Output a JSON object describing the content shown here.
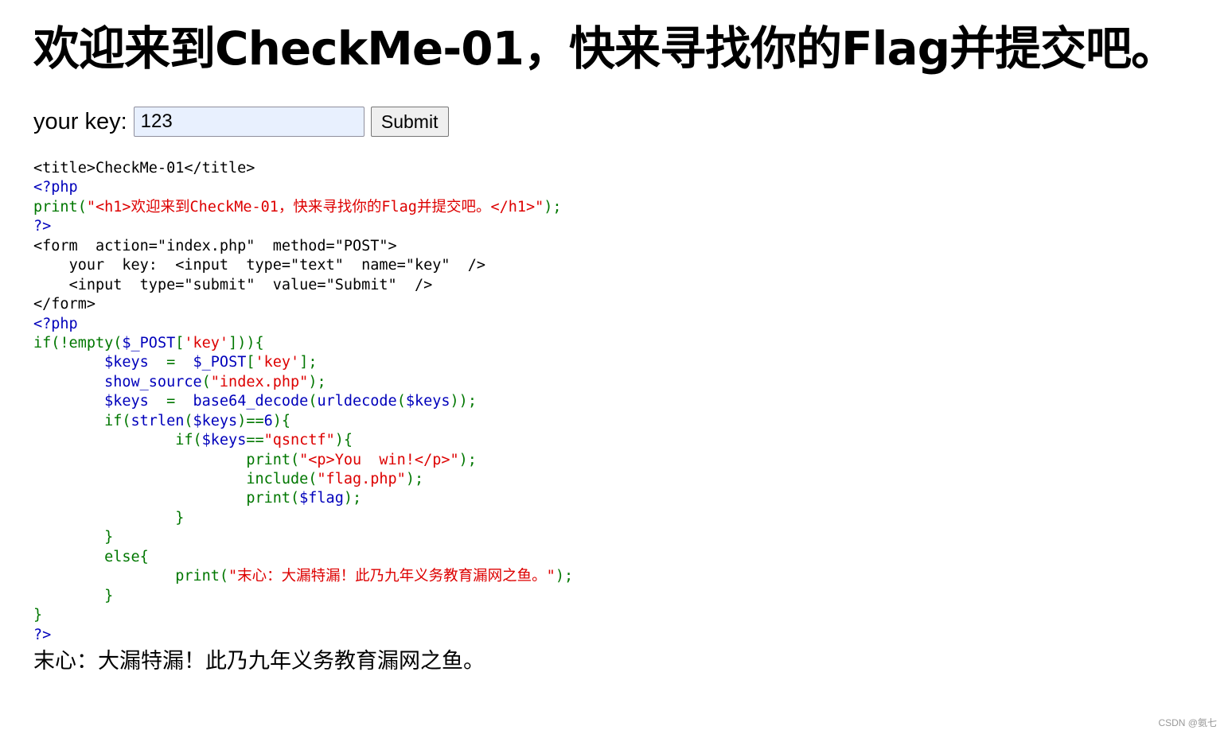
{
  "page": {
    "title": "欢迎来到CheckMe-01，快来寻找你的Flag并提交吧。"
  },
  "form": {
    "key_label": "your key:",
    "key_value": "123",
    "submit_label": "Submit"
  },
  "source_code": {
    "lines": [
      {
        "indent": "",
        "tokens": [
          {
            "t": "<title>CheckMe-01</title>",
            "c": "default"
          }
        ]
      },
      {
        "indent": "",
        "tokens": [
          {
            "t": "<?php",
            "c": "html"
          }
        ]
      },
      {
        "indent": "",
        "tokens": [
          {
            "t": "print(",
            "c": "keyword"
          },
          {
            "t": "\"<h1>欢迎来到CheckMe-01，快来寻找你的Flag并提交吧。</h1>\"",
            "c": "string"
          },
          {
            "t": ");",
            "c": "keyword"
          }
        ]
      },
      {
        "indent": "",
        "tokens": [
          {
            "t": "?>",
            "c": "html"
          }
        ]
      },
      {
        "indent": "",
        "tokens": [
          {
            "t": "<form  action=\"index.php\"  method=\"POST\">",
            "c": "default"
          }
        ]
      },
      {
        "indent": "    ",
        "tokens": [
          {
            "t": "your  key:  <input  type=\"text\"  name=\"key\"  />",
            "c": "default"
          }
        ]
      },
      {
        "indent": "    ",
        "tokens": [
          {
            "t": "<input  type=\"submit\"  value=\"Submit\"  />",
            "c": "default"
          }
        ]
      },
      {
        "indent": "",
        "tokens": [
          {
            "t": "</form>",
            "c": "default"
          }
        ]
      },
      {
        "indent": "",
        "tokens": [
          {
            "t": "<?php",
            "c": "html"
          }
        ]
      },
      {
        "indent": "",
        "tokens": [
          {
            "t": "if(!empty(",
            "c": "keyword"
          },
          {
            "t": "$_POST",
            "c": "var"
          },
          {
            "t": "[",
            "c": "keyword"
          },
          {
            "t": "'key'",
            "c": "string"
          },
          {
            "t": "])){",
            "c": "keyword"
          }
        ]
      },
      {
        "indent": "        ",
        "tokens": [
          {
            "t": "$keys",
            "c": "var"
          },
          {
            "t": "  =  ",
            "c": "keyword"
          },
          {
            "t": "$_POST",
            "c": "var"
          },
          {
            "t": "[",
            "c": "keyword"
          },
          {
            "t": "'key'",
            "c": "string"
          },
          {
            "t": "];",
            "c": "keyword"
          }
        ]
      },
      {
        "indent": "        ",
        "tokens": [
          {
            "t": "show_source",
            "c": "var"
          },
          {
            "t": "(",
            "c": "keyword"
          },
          {
            "t": "\"index.php\"",
            "c": "string"
          },
          {
            "t": ");",
            "c": "keyword"
          }
        ]
      },
      {
        "indent": "        ",
        "tokens": [
          {
            "t": "$keys",
            "c": "var"
          },
          {
            "t": "  =  ",
            "c": "keyword"
          },
          {
            "t": "base64_decode",
            "c": "var"
          },
          {
            "t": "(",
            "c": "keyword"
          },
          {
            "t": "urldecode",
            "c": "var"
          },
          {
            "t": "(",
            "c": "keyword"
          },
          {
            "t": "$keys",
            "c": "var"
          },
          {
            "t": "));",
            "c": "keyword"
          }
        ]
      },
      {
        "indent": "        ",
        "tokens": [
          {
            "t": "if(",
            "c": "keyword"
          },
          {
            "t": "strlen",
            "c": "var"
          },
          {
            "t": "(",
            "c": "keyword"
          },
          {
            "t": "$keys",
            "c": "var"
          },
          {
            "t": ")==",
            "c": "keyword"
          },
          {
            "t": "6",
            "c": "var"
          },
          {
            "t": "){",
            "c": "keyword"
          }
        ]
      },
      {
        "indent": "                ",
        "tokens": [
          {
            "t": "if(",
            "c": "keyword"
          },
          {
            "t": "$keys",
            "c": "var"
          },
          {
            "t": "==",
            "c": "keyword"
          },
          {
            "t": "\"qsnctf\"",
            "c": "string"
          },
          {
            "t": "){",
            "c": "keyword"
          }
        ]
      },
      {
        "indent": "                        ",
        "tokens": [
          {
            "t": "print(",
            "c": "keyword"
          },
          {
            "t": "\"<p>You  win!</p>\"",
            "c": "string"
          },
          {
            "t": ");",
            "c": "keyword"
          }
        ]
      },
      {
        "indent": "                        ",
        "tokens": [
          {
            "t": "include(",
            "c": "keyword"
          },
          {
            "t": "\"flag.php\"",
            "c": "string"
          },
          {
            "t": ");",
            "c": "keyword"
          }
        ]
      },
      {
        "indent": "                        ",
        "tokens": [
          {
            "t": "print(",
            "c": "keyword"
          },
          {
            "t": "$flag",
            "c": "var"
          },
          {
            "t": ");",
            "c": "keyword"
          }
        ]
      },
      {
        "indent": "                ",
        "tokens": [
          {
            "t": "}",
            "c": "keyword"
          }
        ]
      },
      {
        "indent": "        ",
        "tokens": [
          {
            "t": "}",
            "c": "keyword"
          }
        ]
      },
      {
        "indent": "        ",
        "tokens": [
          {
            "t": "else{",
            "c": "keyword"
          }
        ]
      },
      {
        "indent": "                ",
        "tokens": [
          {
            "t": "print(",
            "c": "keyword"
          },
          {
            "t": "\"末心：大漏特漏！此乃九年义务教育漏网之鱼。\"",
            "c": "string"
          },
          {
            "t": ");",
            "c": "keyword"
          }
        ]
      },
      {
        "indent": "        ",
        "tokens": [
          {
            "t": "}",
            "c": "keyword"
          }
        ]
      },
      {
        "indent": "",
        "tokens": [
          {
            "t": "}",
            "c": "keyword"
          }
        ]
      },
      {
        "indent": "",
        "tokens": [
          {
            "t": "?>",
            "c": "html"
          }
        ]
      }
    ]
  },
  "result": {
    "message": "末心：大漏特漏！此乃九年义务教育漏网之鱼。"
  },
  "watermark": {
    "text": "CSDN @氨七"
  },
  "colors": {
    "default": "#000000",
    "html": "#0000BB",
    "keyword": "#007700",
    "string": "#DD0000",
    "var": "#0000BB",
    "input_autofill_bg": "#e8f0fe"
  }
}
